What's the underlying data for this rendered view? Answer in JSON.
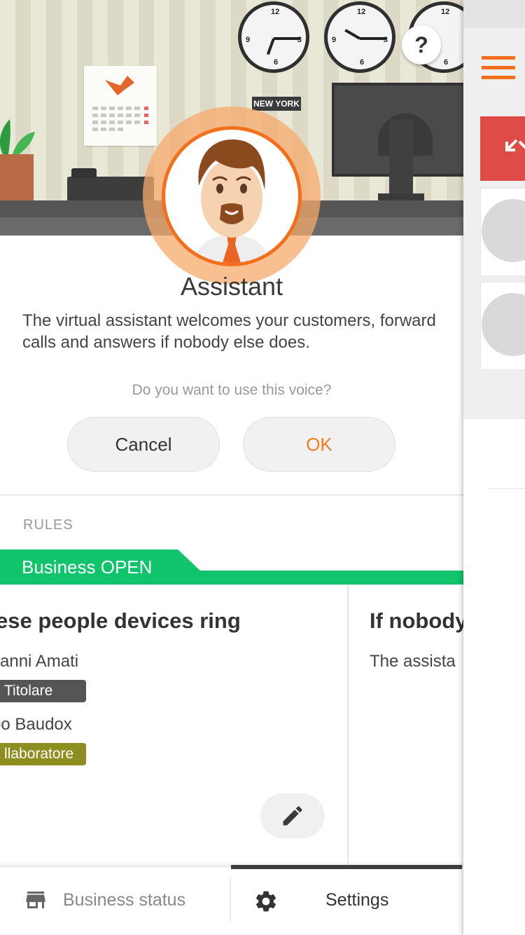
{
  "scene": {
    "city_label": "NEW YORK",
    "clock_numbers": [
      "12",
      "3",
      "6",
      "9"
    ],
    "help_icon": "?"
  },
  "assistant": {
    "title": "Assistant",
    "description": "The virtual assistant welcomes your customers, forward calls and answers if nobody else does.",
    "question": "Do you want to use this voice?",
    "cancel_label": "Cancel",
    "ok_label": "OK"
  },
  "rules": {
    "section_label": "RULES",
    "tab_label": "Business OPEN",
    "card_title": "ese people devices ring",
    "people": [
      {
        "name": "vanni Amati",
        "role": "Titolare"
      },
      {
        "name": "po Baudox",
        "role": "llaboratore"
      }
    ],
    "right_title": "If nobody",
    "right_text": "The assista"
  },
  "bottom_nav": {
    "business_status_label": "Business status",
    "settings_label": "Settings"
  },
  "colors": {
    "accent": "#f36f1b",
    "green": "#0fc46b",
    "red": "#df4b47",
    "badge_dark": "#555555",
    "badge_olive": "#8e8d1f"
  }
}
